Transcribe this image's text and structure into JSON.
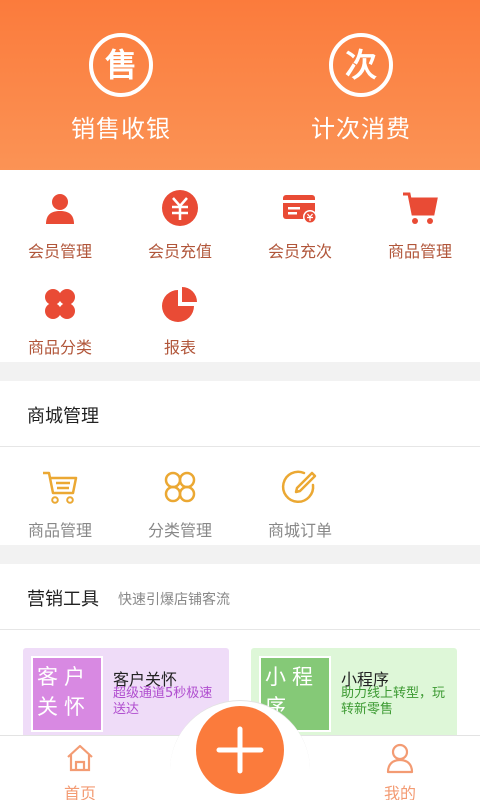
{
  "header": {
    "sale": {
      "glyph": "售",
      "label": "销售收银"
    },
    "count": {
      "glyph": "次",
      "label": "计次消费"
    }
  },
  "grid": {
    "items": [
      {
        "label": "会员管理",
        "icon": "member-icon"
      },
      {
        "label": "会员充值",
        "icon": "yuan-recharge-icon"
      },
      {
        "label": "会员充次",
        "icon": "card-recharge-icon"
      },
      {
        "label": "商品管理",
        "icon": "cart-icon"
      },
      {
        "label": "商品分类",
        "icon": "category-icon"
      },
      {
        "label": "报表",
        "icon": "pie-chart-icon"
      }
    ]
  },
  "mall": {
    "title": "商城管理",
    "items": [
      {
        "label": "商品管理",
        "icon": "cart-outline-icon"
      },
      {
        "label": "分类管理",
        "icon": "category-outline-icon"
      },
      {
        "label": "商城订单",
        "icon": "edit-order-icon"
      }
    ]
  },
  "marketing": {
    "title": "营销工具",
    "subtitle": "快速引爆店铺客流",
    "cards": [
      {
        "thumb": "客户关怀",
        "title": "客户关怀",
        "desc": "超级通道5秒极速送达"
      },
      {
        "thumb": "小程序",
        "title": "小程序",
        "desc": "助力线上转型，玩转新零售"
      }
    ]
  },
  "nav": {
    "home": "首页",
    "mine": "我的"
  },
  "colors": {
    "accent": "#fb7b3c",
    "icon_red": "#e94b35",
    "icon_gold": "#eba833",
    "nav_label": "#f39b73"
  }
}
